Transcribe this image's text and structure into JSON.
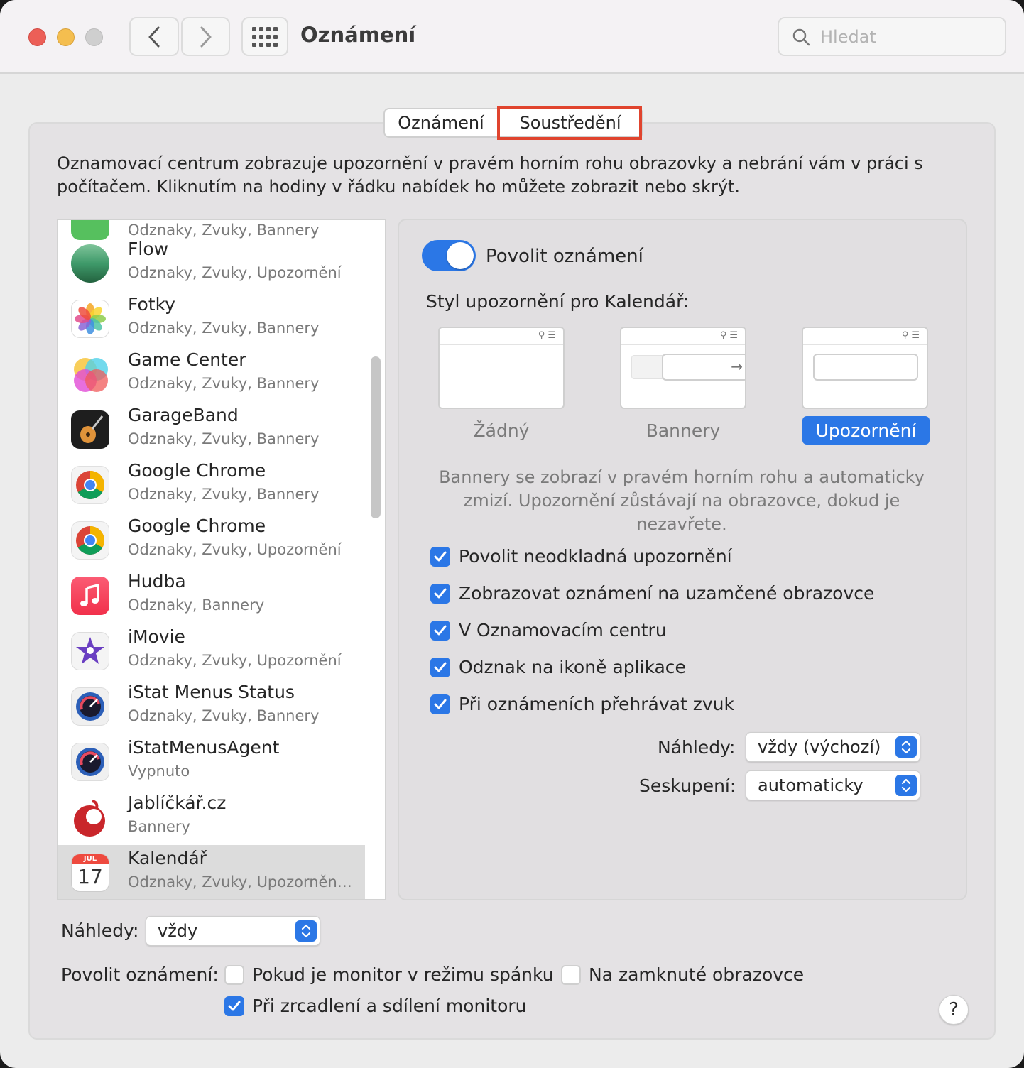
{
  "window": {
    "title": "Oznámení",
    "search_placeholder": "Hledat"
  },
  "tabs": [
    {
      "label": "Oznámení"
    },
    {
      "label": "Soustředění"
    }
  ],
  "description": "Oznamovací centrum zobrazuje upozornění v pravém horním rohu obrazovky a nebrání vám v práci s počítačem. Kliknutím na hodiny v řádku nabídek ho můžete zobrazit nebo skrýt.",
  "apps": [
    {
      "name": "",
      "sub": "Odznaky, Zvuky, Bannery"
    },
    {
      "name": "Flow",
      "sub": "Odznaky, Zvuky, Upozornění"
    },
    {
      "name": "Fotky",
      "sub": "Odznaky, Zvuky, Bannery"
    },
    {
      "name": "Game Center",
      "sub": "Odznaky, Zvuky, Bannery"
    },
    {
      "name": "GarageBand",
      "sub": "Odznaky, Zvuky, Bannery"
    },
    {
      "name": "Google Chrome",
      "sub": "Odznaky, Zvuky, Bannery"
    },
    {
      "name": "Google Chrome",
      "sub": "Odznaky, Zvuky, Upozornění"
    },
    {
      "name": "Hudba",
      "sub": "Odznaky, Bannery"
    },
    {
      "name": "iMovie",
      "sub": "Odznaky, Zvuky, Upozornění"
    },
    {
      "name": "iStat Menus Status",
      "sub": "Odznaky, Zvuky, Bannery"
    },
    {
      "name": "iStatMenusAgent",
      "sub": "Vypnuto"
    },
    {
      "name": "Jablíčkář.cz",
      "sub": "Bannery"
    },
    {
      "name": "Kalendář",
      "sub": "Odznaky, Zvuky, Upozornění…",
      "icon_month": "JUL",
      "icon_day": "17",
      "selected": true
    }
  ],
  "detail": {
    "allow_label": "Povolit oznámení",
    "allow_on": true,
    "style_heading": "Styl upozornění pro Kalendář:",
    "styles": [
      "Žádný",
      "Bannery",
      "Upozornění"
    ],
    "selected_style": "Upozornění",
    "style_explain": "Bannery se zobrazí v pravém horním rohu a automaticky zmizí. Upozornění zůstávají na obrazovce, dokud je nezavřete.",
    "options": [
      {
        "label": "Povolit neodkladná upozornění",
        "checked": true
      },
      {
        "label": "Zobrazovat oznámení na uzamčené obrazovce",
        "checked": true
      },
      {
        "label": "V Oznamovacím centru",
        "checked": true
      },
      {
        "label": "Odznak na ikoně aplikace",
        "checked": true
      },
      {
        "label": "Při oznámeních přehrávat zvuk",
        "checked": true
      }
    ],
    "previews_label": "Náhledy:",
    "previews_value": "vždy (výchozí)",
    "grouping_label": "Seskupení:",
    "grouping_value": "automaticky"
  },
  "bottom": {
    "previews_label": "Náhledy:",
    "previews_value": "vždy",
    "allow_label": "Povolit oznámení:",
    "sleep_label": "Pokud je monitor v režimu spánku",
    "sleep_checked": false,
    "locked_label": "Na zamknuté obrazovce",
    "locked_checked": false,
    "mirror_label": "Při zrcadlení a sdílení monitoru",
    "mirror_checked": true,
    "help_label": "?"
  },
  "colors": {
    "accent": "#2b77e6",
    "highlight_box": "#e0442e"
  }
}
